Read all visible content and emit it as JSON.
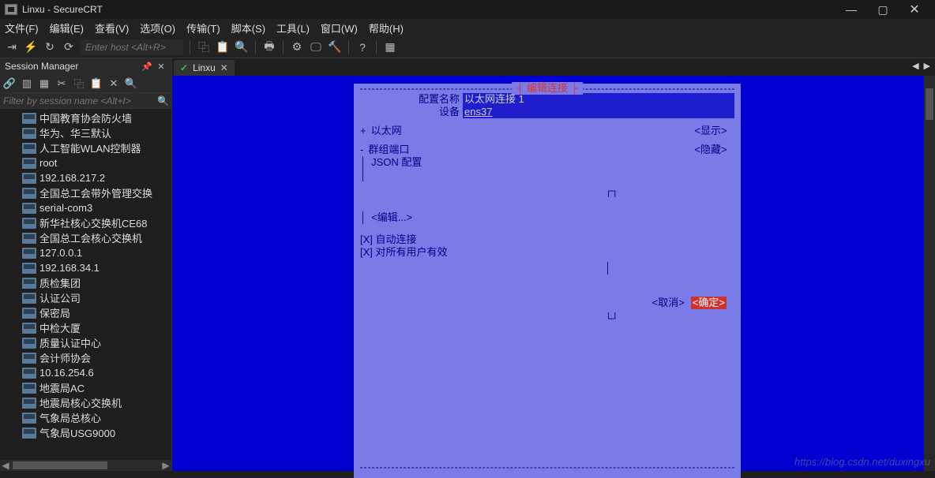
{
  "window": {
    "title": "Linxu - SecureCRT"
  },
  "win_buttons": {
    "min": "—",
    "max": "▢",
    "close": "✕"
  },
  "menu": {
    "file": "文件(F)",
    "edit": "编辑(E)",
    "view": "查看(V)",
    "options": "选项(O)",
    "transfer": "传输(T)",
    "script": "脚本(S)",
    "tools": "工具(L)",
    "window": "窗口(W)",
    "help": "帮助(H)"
  },
  "toolbar": {
    "host_placeholder": "Enter host <Alt+R>",
    "icons": {
      "plug": "⇥",
      "bolt": "⚡",
      "refresh": "↻",
      "loop": "⟳",
      "copy": "⿻",
      "paste": "📋",
      "search": "🔍",
      "print": "🖶",
      "gear": "⚙",
      "screen": "🖵",
      "hammer": "🔨",
      "help": "?",
      "app": "▦"
    }
  },
  "panel": {
    "title": "Session Manager",
    "pin": "📌",
    "close": "✕",
    "tool_icons": {
      "link": "🔗",
      "new": "▥",
      "new2": "▦",
      "cut": "✂",
      "copy": "⿻",
      "paste": "📋",
      "del": "✕",
      "find": "🔍"
    },
    "filter_placeholder": "Filter by session name <Alt+I>",
    "items": [
      "中国教育协会防火墙",
      "华为、华三默认",
      "人工智能WLAN控制器",
      "root",
      "192.168.217.2",
      "全国总工会带外管理交换",
      "serial-com3",
      "新华社核心交换机CE68",
      "全国总工会核心交换机",
      "127.0.0.1",
      "192.168.34.1",
      "质检集团",
      "认证公司",
      "保密局",
      "中检大厦",
      "质量认证中心",
      "会计师协会",
      "10.16.254.6",
      "地震局AC",
      "地震局核心交换机",
      "气象局总核心",
      "气象局USG9000"
    ],
    "scroll_left": "◀",
    "scroll_right": "▶"
  },
  "tab": {
    "check": "✓",
    "label": "Linxu",
    "close": "✕",
    "nav_left": "◀",
    "nav_right": "▶"
  },
  "terminal": {
    "dialog_title": "编辑连接",
    "lbl_config_name": "配置名称",
    "val_config_name": "以太网连接 1",
    "lbl_device": "设备",
    "val_device": "ens37",
    "ethernet": "以太网",
    "show": "<显示>",
    "group_port": "群组端口",
    "json_cfg": "JSON 配置",
    "hide": "<隐藏>",
    "edit": "<编辑...>",
    "auto_connect": "[X] 自动连接",
    "all_users": "[X] 对所有用户有效",
    "cancel": "<取消>",
    "ok": "<确定>",
    "bar": "┆"
  },
  "watermark": "https://blog.csdn.net/duxingxu"
}
